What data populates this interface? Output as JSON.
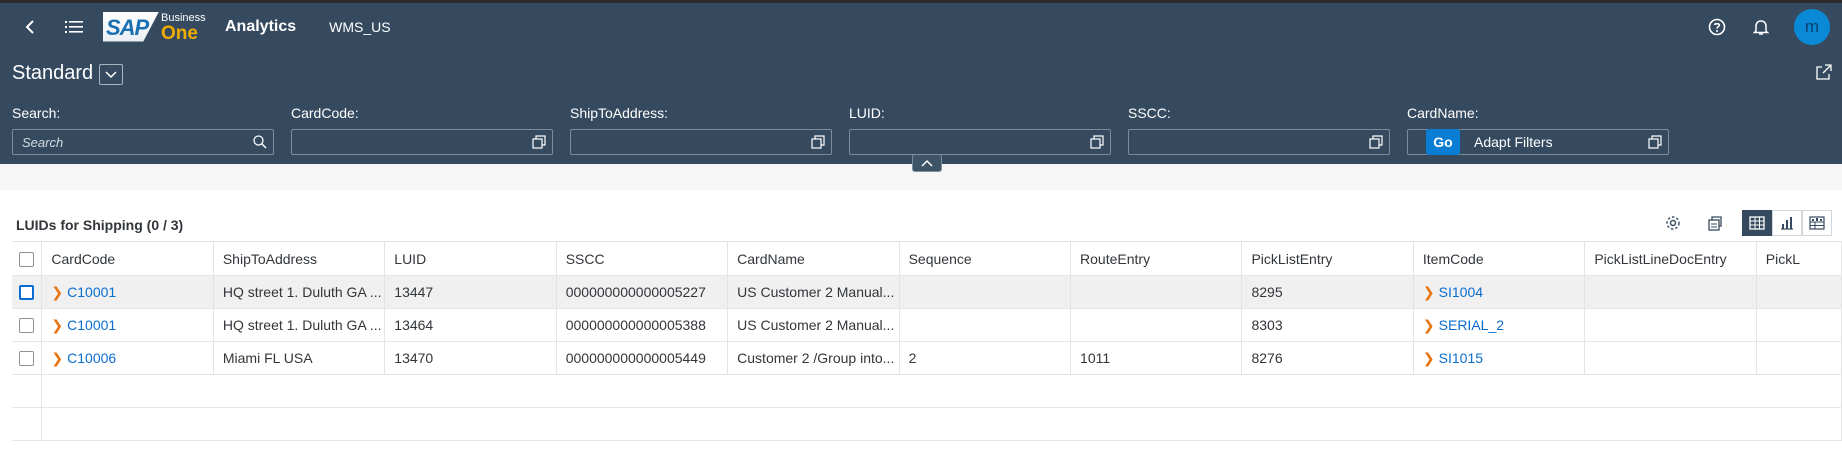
{
  "shell": {
    "logo_text": "SAP",
    "logo_sub": "Business",
    "logo_one": "One",
    "app_title": "Analytics",
    "company": "WMS_US",
    "avatar": "m"
  },
  "header": {
    "variant": "Standard",
    "filters": [
      {
        "label": "Search:",
        "placeholder": "Search"
      },
      {
        "label": "CardCode:",
        "placeholder": ""
      },
      {
        "label": "ShipToAddress:",
        "placeholder": ""
      },
      {
        "label": "LUID:",
        "placeholder": ""
      },
      {
        "label": "SSCC:",
        "placeholder": ""
      },
      {
        "label": "CardName:",
        "placeholder": ""
      }
    ],
    "go": "Go",
    "adapt": "Adapt Filters"
  },
  "table": {
    "title": "LUIDs for Shipping (0 / 3)",
    "columns": [
      "CardCode",
      "ShipToAddress",
      "LUID",
      "SSCC",
      "CardName",
      "Sequence",
      "RouteEntry",
      "PickListEntry",
      "ItemCode",
      "PickListLineDocEntry",
      "PickL"
    ],
    "rows": [
      [
        "C10001",
        "HQ street 1. Duluth GA ...",
        "13447",
        "000000000000005227",
        "US Customer 2 Manual...",
        "",
        "",
        "8295",
        "SI1004",
        "",
        ""
      ],
      [
        "C10001",
        "HQ street 1. Duluth GA ...",
        "13464",
        "000000000000005388",
        "US Customer 2 Manual...",
        "",
        "",
        "8303",
        "SERIAL_2",
        "",
        ""
      ],
      [
        "C10006",
        "Miami FL USA",
        "13470",
        "000000000000005449",
        "Customer 2 /Group into...",
        "2",
        "1011",
        "8276",
        "SI1015",
        "",
        ""
      ]
    ]
  },
  "colors": {
    "shell": "#354a5f",
    "link": "#0a6ed1",
    "accent_arrow": "#e9730c",
    "go_button": "#0a7dd4"
  }
}
